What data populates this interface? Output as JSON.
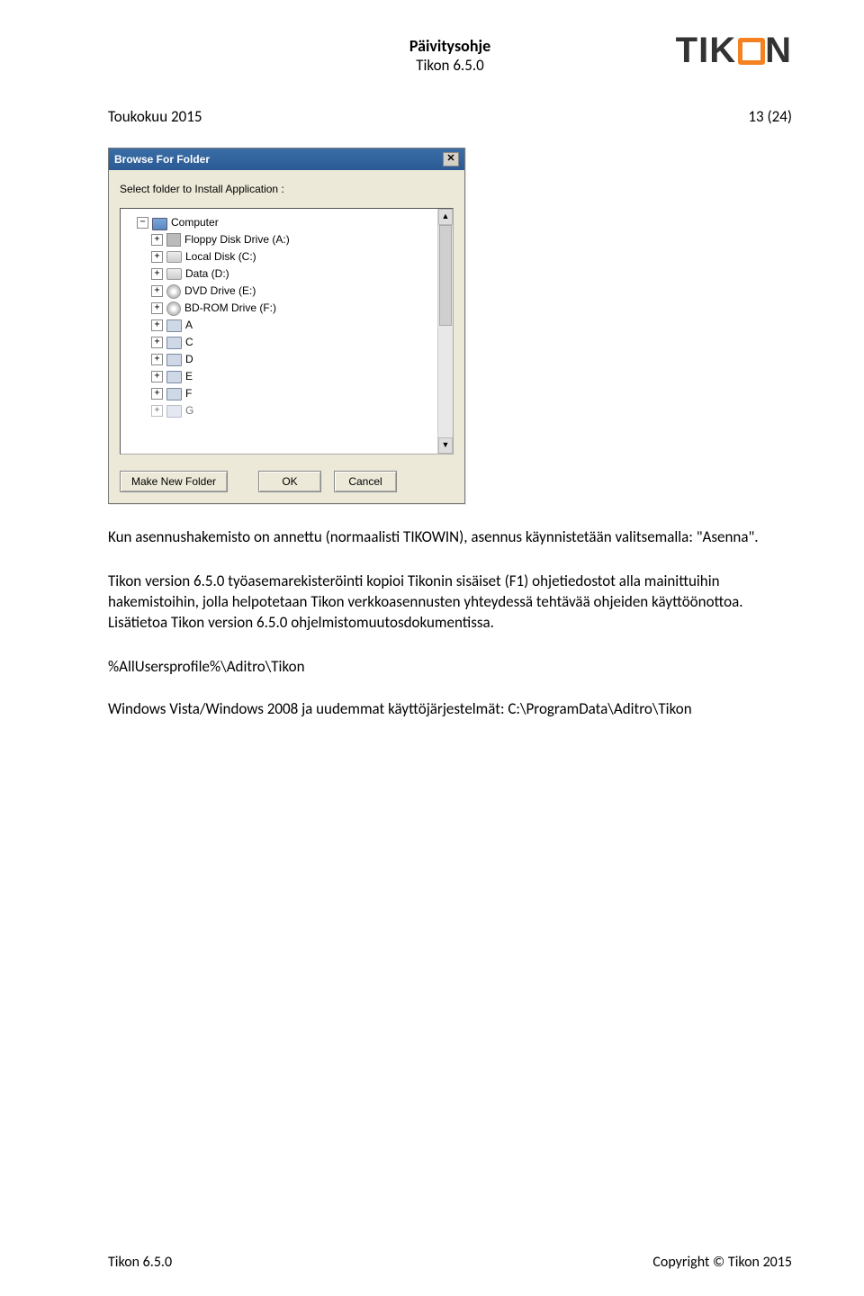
{
  "header": {
    "title": "Päivitysohje",
    "subtitle": "Tikon 6.5.0",
    "logo_text_pre": "TIK",
    "logo_text_post": "N"
  },
  "meta": {
    "date": "Toukokuu 2015",
    "page": "13 (24)"
  },
  "dialog": {
    "title": "Browse For Folder",
    "instruction": "Select folder to Install Application :",
    "tree": {
      "root": "Computer",
      "items": [
        {
          "label": "Floppy Disk Drive (A:)",
          "icon": "floppy"
        },
        {
          "label": "Local Disk (C:)",
          "icon": "hdd"
        },
        {
          "label": "Data (D:)",
          "icon": "hdd"
        },
        {
          "label": "DVD Drive (E:)",
          "icon": "cd"
        },
        {
          "label": "BD-ROM Drive (F:)",
          "icon": "cd"
        },
        {
          "label": "A",
          "icon": "net"
        },
        {
          "label": "C",
          "icon": "net"
        },
        {
          "label": "D",
          "icon": "net"
        },
        {
          "label": "E",
          "icon": "net"
        },
        {
          "label": "F",
          "icon": "net"
        },
        {
          "label": "G",
          "icon": "net"
        }
      ]
    },
    "buttons": {
      "make_new_folder": "Make New Folder",
      "ok": "OK",
      "cancel": "Cancel"
    }
  },
  "body": {
    "para1": "Kun asennushakemisto on annettu (normaalisti TIKOWIN), asennus käynnistetään valitsemalla: \"Asenna\".",
    "para2": "Tikon version 6.5.0 työasemarekisteröinti kopioi Tikonin sisäiset (F1) ohjetiedostot alla mainittuihin hakemistoihin, jolla helpotetaan Tikon verkkoasennusten yhteydessä tehtävää ohjeiden käyttöönottoa. Lisätietoa Tikon version 6.5.0 ohjelmistomuutosdokumentissa.",
    "path1": "%AllUsersprofile%\\Aditro\\Tikon",
    "path2": "Windows Vista/Windows 2008 ja uudemmat käyttöjärjestelmät: C:\\ProgramData\\Aditro\\Tikon"
  },
  "footer": {
    "left": "Tikon 6.5.0",
    "right": "Copyright © Tikon 2015"
  }
}
